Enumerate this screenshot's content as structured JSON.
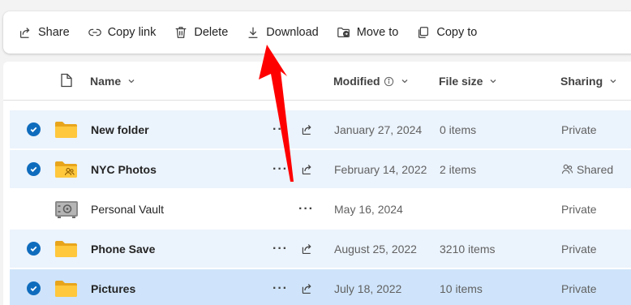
{
  "toolbar": {
    "share": "Share",
    "copy_link": "Copy link",
    "delete": "Delete",
    "download": "Download",
    "move_to": "Move to",
    "copy_to": "Copy to"
  },
  "columns": {
    "name": "Name",
    "modified": "Modified",
    "file_size": "File size",
    "sharing": "Sharing"
  },
  "rows": [
    {
      "name": "New folder",
      "modified": "January 27, 2024",
      "size": "0 items",
      "sharing": "Private",
      "selected": true,
      "icon": "folder-icon"
    },
    {
      "name": "NYC Photos",
      "modified": "February 14, 2022",
      "size": "2 items",
      "sharing": "Shared",
      "selected": true,
      "icon": "shared-folder-icon"
    },
    {
      "name": "Personal Vault",
      "modified": "May 16, 2024",
      "size": "",
      "sharing": "Private",
      "selected": false,
      "icon": "vault-icon"
    },
    {
      "name": "Phone Save",
      "modified": "August 25, 2022",
      "size": "3210 items",
      "sharing": "Private",
      "selected": true,
      "icon": "folder-icon"
    },
    {
      "name": "Pictures",
      "modified": "July 18, 2022",
      "size": "10 items",
      "sharing": "Private",
      "selected": true,
      "icon": "folder-icon"
    }
  ],
  "more_glyph": "···",
  "colors": {
    "accent": "#0f6cbd",
    "folder": "#ffc83d",
    "arrow": "#ff0000",
    "selected_row": "#ebf3fc"
  }
}
